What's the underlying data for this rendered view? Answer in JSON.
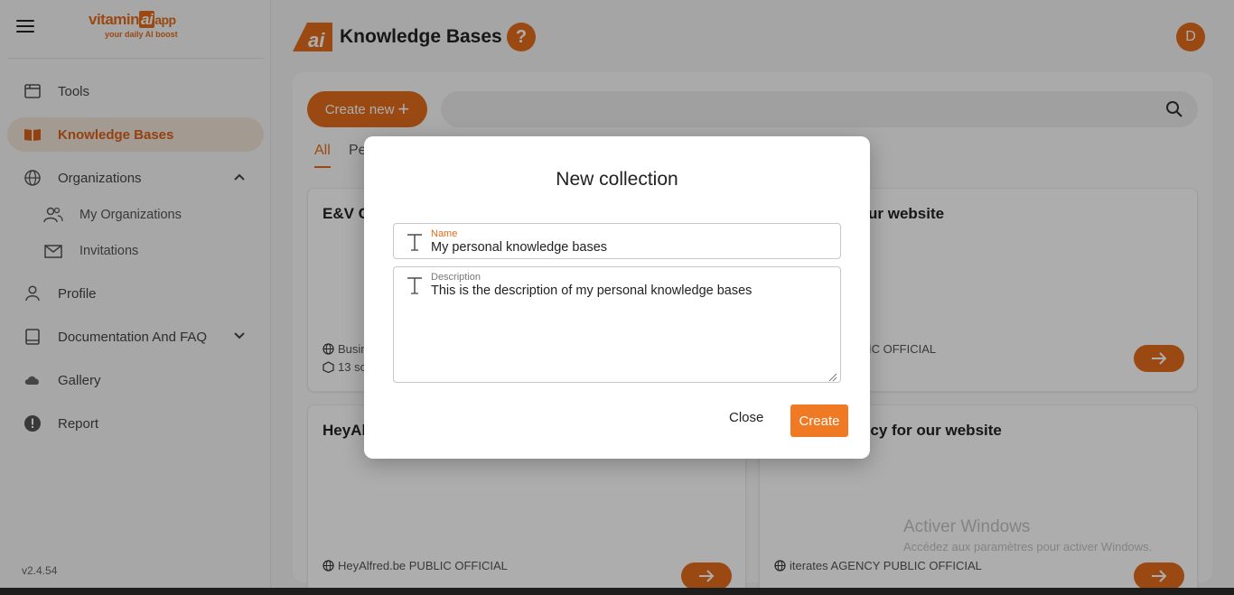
{
  "brand": {
    "logo_main": "vitamin",
    "logo_ai": "ai",
    "logo_app": "app",
    "tagline": "your daily AI boost"
  },
  "sidebar": {
    "items": [
      {
        "label": "Tools",
        "icon": "calendar-icon"
      },
      {
        "label": "Knowledge Bases",
        "icon": "book-icon",
        "active": true
      },
      {
        "label": "Organizations",
        "icon": "globe-icon",
        "expanded": true
      },
      {
        "label": "My Organizations",
        "icon": "people-icon"
      },
      {
        "label": "Invitations",
        "icon": "mail-icon"
      },
      {
        "label": "Profile",
        "icon": "person-icon"
      },
      {
        "label": "Documentation And FAQ",
        "icon": "book-outline-icon"
      },
      {
        "label": "Gallery",
        "icon": "cloud-icon"
      },
      {
        "label": "Report",
        "icon": "alert-icon"
      }
    ],
    "version": "v2.4.54"
  },
  "header": {
    "title": "Knowledge Bases",
    "help": "?",
    "avatar_initial": "D"
  },
  "main": {
    "create_new_label": "Create new",
    "search_placeholder": "",
    "tabs": [
      {
        "label": "All",
        "active": true
      },
      {
        "label": "Pe"
      }
    ],
    "cards": [
      {
        "title": "E&V C",
        "meta1": "Busin",
        "meta2": "13 so"
      },
      {
        "title": "ur website",
        "meta1": "IC OFFICIAL"
      },
      {
        "title": "HeyAl",
        "meta1": "HeyAlfred.be PUBLIC OFFICIAL"
      },
      {
        "title": "ncy for our website",
        "meta1": "iterates AGENCY PUBLIC OFFICIAL"
      }
    ]
  },
  "dialog": {
    "title": "New collection",
    "name_label": "Name",
    "name_value": "My personal knowledge bases",
    "description_label": "Description",
    "description_value": "This is the description of my personal knowledge bases",
    "close_label": "Close",
    "create_label": "Create"
  },
  "watermark": {
    "line1": "Activer Windows",
    "line2": "Accédez aux paramètres pour activer Windows."
  },
  "colors": {
    "accent": "#e36c1c",
    "active_bg": "#f1e3d8",
    "button": "#f07a24"
  }
}
